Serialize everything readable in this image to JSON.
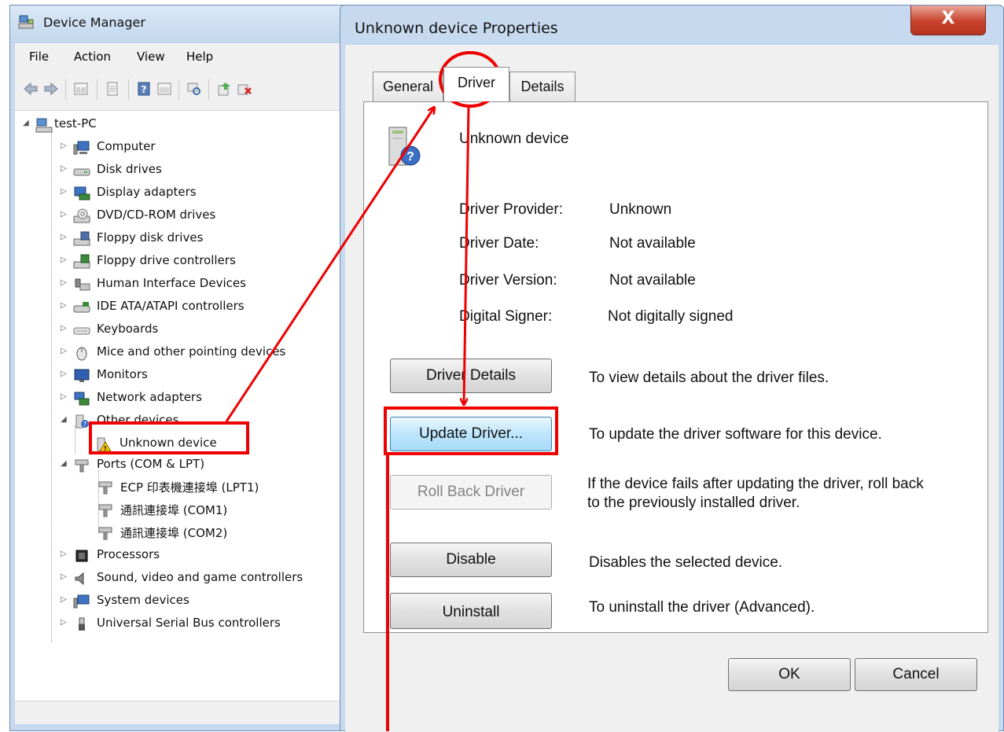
{
  "device_manager": {
    "title": "Device Manager",
    "menu": [
      "File",
      "Action",
      "View",
      "Help"
    ],
    "toolbar_icons": [
      "back-arrow-icon",
      "forward-arrow-icon",
      "show-hide-tree-icon",
      "properties-icon",
      "help-icon",
      "view-icon",
      "scan-hardware-icon",
      "update-driver-icon",
      "uninstall-icon"
    ],
    "tree": {
      "root": "test-PC",
      "categories": [
        {
          "label": "Computer",
          "icon": "computer-icon"
        },
        {
          "label": "Disk drives",
          "icon": "disk-drive-icon"
        },
        {
          "label": "Display adapters",
          "icon": "display-adapter-icon"
        },
        {
          "label": "DVD/CD-ROM drives",
          "icon": "dvd-drive-icon"
        },
        {
          "label": "Floppy disk drives",
          "icon": "floppy-disk-icon"
        },
        {
          "label": "Floppy drive controllers",
          "icon": "floppy-controller-icon"
        },
        {
          "label": "Human Interface Devices",
          "icon": "hid-icon"
        },
        {
          "label": "IDE ATA/ATAPI controllers",
          "icon": "ide-controller-icon"
        },
        {
          "label": "Keyboards",
          "icon": "keyboard-icon"
        },
        {
          "label": "Mice and other pointing devices",
          "icon": "mouse-icon"
        },
        {
          "label": "Monitors",
          "icon": "monitor-icon"
        },
        {
          "label": "Network adapters",
          "icon": "network-adapter-icon"
        },
        {
          "label": "Other devices",
          "icon": "other-devices-icon"
        },
        {
          "label": "Unknown device",
          "icon": "unknown-device-warning-icon"
        },
        {
          "label": "Ports (COM & LPT)",
          "icon": "port-icon"
        },
        {
          "label": "ECP 印表機連接埠 (LPT1)",
          "icon": "port-icon"
        },
        {
          "label": "通訊連接埠 (COM1)",
          "icon": "port-icon"
        },
        {
          "label": "通訊連接埠 (COM2)",
          "icon": "port-icon"
        },
        {
          "label": "Processors",
          "icon": "processor-icon"
        },
        {
          "label": "Sound, video and game controllers",
          "icon": "sound-icon"
        },
        {
          "label": "System devices",
          "icon": "system-devices-icon"
        },
        {
          "label": "Universal Serial Bus controllers",
          "icon": "usb-icon"
        }
      ]
    }
  },
  "properties": {
    "title": "Unknown device Properties",
    "close_label": "X",
    "tabs": [
      "General",
      "Driver",
      "Details"
    ],
    "active_tab": "Driver",
    "device_name": "Unknown device",
    "info": [
      {
        "label": "Driver Provider:",
        "value": "Unknown"
      },
      {
        "label": "Driver Date:",
        "value": "Not available"
      },
      {
        "label": "Driver Version:",
        "value": "Not available"
      },
      {
        "label": "Digital Signer:",
        "value": "Not digitally signed"
      }
    ],
    "actions": [
      {
        "label": "Driver Details",
        "desc": "To view details about the driver files."
      },
      {
        "label": "Update Driver...",
        "desc": "To update the driver software for this device."
      },
      {
        "label": "Roll Back Driver",
        "desc": "If the device fails after updating the driver, roll back to the previously installed driver."
      },
      {
        "label": "Disable",
        "desc": "Disables the selected device."
      },
      {
        "label": "Uninstall",
        "desc": "To uninstall the driver (Advanced)."
      }
    ],
    "ok_label": "OK",
    "cancel_label": "Cancel"
  },
  "colors": {
    "annotation": "#ee0000",
    "window_frame": "#c6d9ee",
    "primary_button": "#bee6fd"
  }
}
